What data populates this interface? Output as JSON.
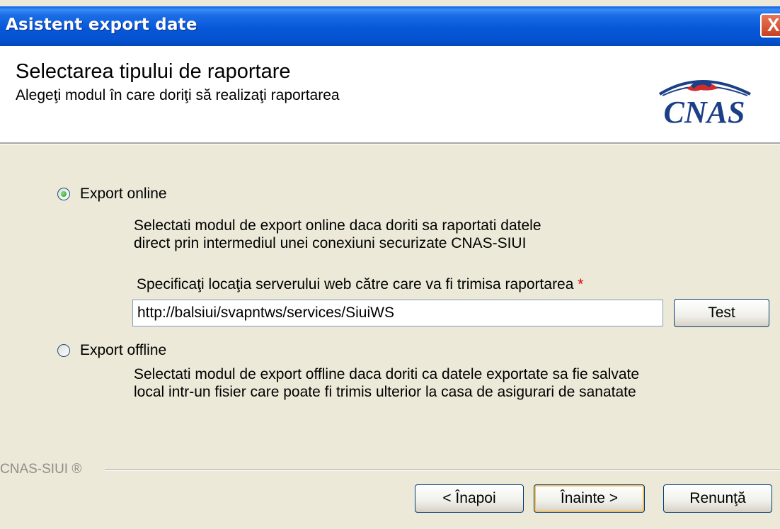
{
  "window": {
    "title": "Asistent export date",
    "close_glyph": "X"
  },
  "header": {
    "title": "Selectarea tipului de raportare",
    "subtitle": "Alegeţi modul în care doriţi să realizaţi raportarea",
    "logo_text": "CNAS"
  },
  "options": {
    "online": {
      "label": "Export online",
      "selected": true,
      "desc_line1": "Selectati modul de export online daca doriti sa raportati datele",
      "desc_line2": "direct prin intermediul unei conexiuni securizate CNAS-SIUI"
    },
    "server": {
      "label": "Specificaţi locaţia serverului web către care va fi trimisa raportarea",
      "required_mark": "*",
      "value": "http://balsiui/svapntws/services/SiuiWS",
      "test_label": "Test"
    },
    "offline": {
      "label": "Export offline",
      "selected": false,
      "desc_line1": "Selectati modul de export offline daca doriti ca datele exportate sa fie salvate",
      "desc_line2": "local intr-un fisier care poate fi trimis ulterior la casa de asigurari de sanatate"
    }
  },
  "footer": {
    "brand": "CNAS-SIUI ®",
    "back_label": "< Înapoi",
    "next_label": "Înainte >",
    "cancel_label": "Renunţă"
  },
  "colors": {
    "titlebar": "#0757d9",
    "face": "#ece9d8",
    "logo_blue": "#1c3f86",
    "logo_red": "#d12b2b",
    "required": "#e00000"
  }
}
